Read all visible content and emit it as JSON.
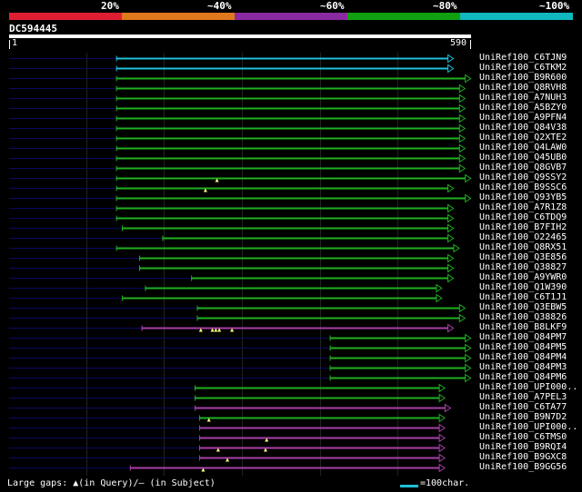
{
  "colors": {
    "cyan": "#1ec0d6",
    "green": "#1fb01f",
    "magenta": "#a83fa8",
    "red": "#e01e32",
    "orange": "#e0781e",
    "purple": "#8a2aa0",
    "bright_green": "#10a010",
    "teal": "#10b0b8",
    "query_line": "#0a0a60"
  },
  "identity_scale": {
    "labels": [
      "20%",
      "~40%",
      "~60%",
      "~80%",
      "~100%"
    ],
    "band_colors": [
      "#e01e32",
      "#e0781e",
      "#8a2aa0",
      "#10a010",
      "#10b8c0"
    ]
  },
  "query": {
    "name": "DC594445",
    "start_label": "1",
    "end_label": "590",
    "length": 590
  },
  "hits": [
    {
      "name": "UniRef100_C6TJN9",
      "start": 186,
      "end": 760,
      "color": "cyan",
      "arrow": true
    },
    {
      "name": "UniRef100_C6TKM2",
      "start": 186,
      "end": 760,
      "color": "cyan",
      "arrow": true
    },
    {
      "name": "UniRef100_B9R600",
      "start": 186,
      "end": 790,
      "color": "green",
      "arrow": true
    },
    {
      "name": "UniRef100_Q8RVH8",
      "start": 186,
      "end": 780,
      "color": "green",
      "arrow": true
    },
    {
      "name": "UniRef100_A7NUH3",
      "start": 186,
      "end": 780,
      "color": "green",
      "arrow": true
    },
    {
      "name": "UniRef100_A5BZY0",
      "start": 186,
      "end": 780,
      "color": "green",
      "arrow": true
    },
    {
      "name": "UniRef100_A9PFN4",
      "start": 186,
      "end": 780,
      "color": "green",
      "arrow": true
    },
    {
      "name": "UniRef100_Q84V38",
      "start": 186,
      "end": 780,
      "color": "green",
      "arrow": true
    },
    {
      "name": "UniRef100_Q2XTE2",
      "start": 186,
      "end": 780,
      "color": "green",
      "arrow": true
    },
    {
      "name": "UniRef100_Q4LAW0",
      "start": 186,
      "end": 780,
      "color": "green",
      "arrow": true
    },
    {
      "name": "UniRef100_Q45UB0",
      "start": 186,
      "end": 780,
      "color": "green",
      "arrow": true
    },
    {
      "name": "UniRef100_Q8GVB7",
      "start": 186,
      "end": 780,
      "color": "green",
      "arrow": true
    },
    {
      "name": "UniRef100_Q9SSY2",
      "start": 186,
      "end": 790,
      "color": "green",
      "arrow": true,
      "query_gap": 360
    },
    {
      "name": "UniRef100_B9SSC6",
      "start": 186,
      "end": 760,
      "color": "green",
      "arrow": true,
      "query_gap": 340
    },
    {
      "name": "UniRef100_Q93YB5",
      "start": 186,
      "end": 790,
      "color": "green",
      "arrow": true
    },
    {
      "name": "UniRef100_A7R1Z8",
      "start": 186,
      "end": 760,
      "color": "green",
      "arrow": true
    },
    {
      "name": "UniRef100_C6TDQ9",
      "start": 186,
      "end": 760,
      "color": "green",
      "arrow": true
    },
    {
      "name": "UniRef100_B7FIH2",
      "start": 196,
      "end": 760,
      "color": "green",
      "arrow": true
    },
    {
      "name": "UniRef100_O22465",
      "start": 266,
      "end": 760,
      "color": "green",
      "arrow": true
    },
    {
      "name": "UniRef100_Q8RX51",
      "start": 186,
      "end": 770,
      "color": "green",
      "arrow": true
    },
    {
      "name": "UniRef100_Q3E856",
      "start": 226,
      "end": 760,
      "color": "green",
      "arrow": true
    },
    {
      "name": "UniRef100_Q38827",
      "start": 226,
      "end": 760,
      "color": "green",
      "arrow": true
    },
    {
      "name": "UniRef100_A9YWR0",
      "start": 316,
      "end": 760,
      "color": "green",
      "arrow": true
    },
    {
      "name": "UniRef100_Q1W390",
      "start": 236,
      "end": 740,
      "color": "green",
      "arrow": true
    },
    {
      "name": "UniRef100_C6T1J1",
      "start": 196,
      "end": 740,
      "color": "green",
      "arrow": true
    },
    {
      "name": "UniRef100_Q3EBW5",
      "start": 326,
      "end": 780,
      "color": "green",
      "arrow": true
    },
    {
      "name": "UniRef100_Q38826",
      "start": 326,
      "end": 780,
      "color": "green",
      "arrow": true
    },
    {
      "name": "UniRef100_B8LKF9",
      "start": 230,
      "end": 760,
      "color": "magenta",
      "arrow": true,
      "query_gaps": [
        332,
        352,
        358,
        364,
        386
      ]
    },
    {
      "name": "UniRef100_Q84PM7",
      "start": 556,
      "end": 790,
      "color": "green",
      "arrow": true
    },
    {
      "name": "UniRef100_Q84PM5",
      "start": 556,
      "end": 790,
      "color": "green",
      "arrow": true
    },
    {
      "name": "UniRef100_Q84PM4",
      "start": 556,
      "end": 790,
      "color": "green",
      "arrow": true
    },
    {
      "name": "UniRef100_Q84PM3",
      "start": 556,
      "end": 790,
      "color": "green",
      "arrow": true
    },
    {
      "name": "UniRef100_Q84PM6",
      "start": 556,
      "end": 790,
      "color": "green",
      "arrow": true
    },
    {
      "name": "UniRef100_UPI000..",
      "start": 322,
      "end": 745,
      "color": "green",
      "arrow": true
    },
    {
      "name": "UniRef100_A7PEL3",
      "start": 322,
      "end": 745,
      "color": "green",
      "arrow": true
    },
    {
      "name": "UniRef100_C6TA77",
      "start": 322,
      "end": 755,
      "color": "magenta",
      "arrow": true
    },
    {
      "name": "UniRef100_B9N7D2",
      "start": 330,
      "end": 745,
      "color": "green",
      "arrow": true,
      "query_gap": 346
    },
    {
      "name": "UniRef100_UPI000..",
      "start": 330,
      "end": 745,
      "color": "magenta",
      "arrow": true
    },
    {
      "name": "UniRef100_C6TMS0",
      "start": 330,
      "end": 745,
      "color": "magenta",
      "arrow": true,
      "query_gap": 446
    },
    {
      "name": "UniRef100_B9RQI4",
      "start": 330,
      "end": 745,
      "color": "magenta",
      "arrow": true,
      "query_gaps": [
        362,
        444
      ]
    },
    {
      "name": "UniRef100_B9GXC8",
      "start": 330,
      "end": 745,
      "color": "magenta",
      "arrow": true,
      "query_gap": 378
    },
    {
      "name": "UniRef100_B9GG56",
      "start": 210,
      "end": 745,
      "color": "magenta",
      "arrow": true,
      "query_gap": 336
    }
  ],
  "footer": {
    "text": "Large gaps: ▲(in Query)/– (in Subject)",
    "scale_label": "=100char."
  }
}
